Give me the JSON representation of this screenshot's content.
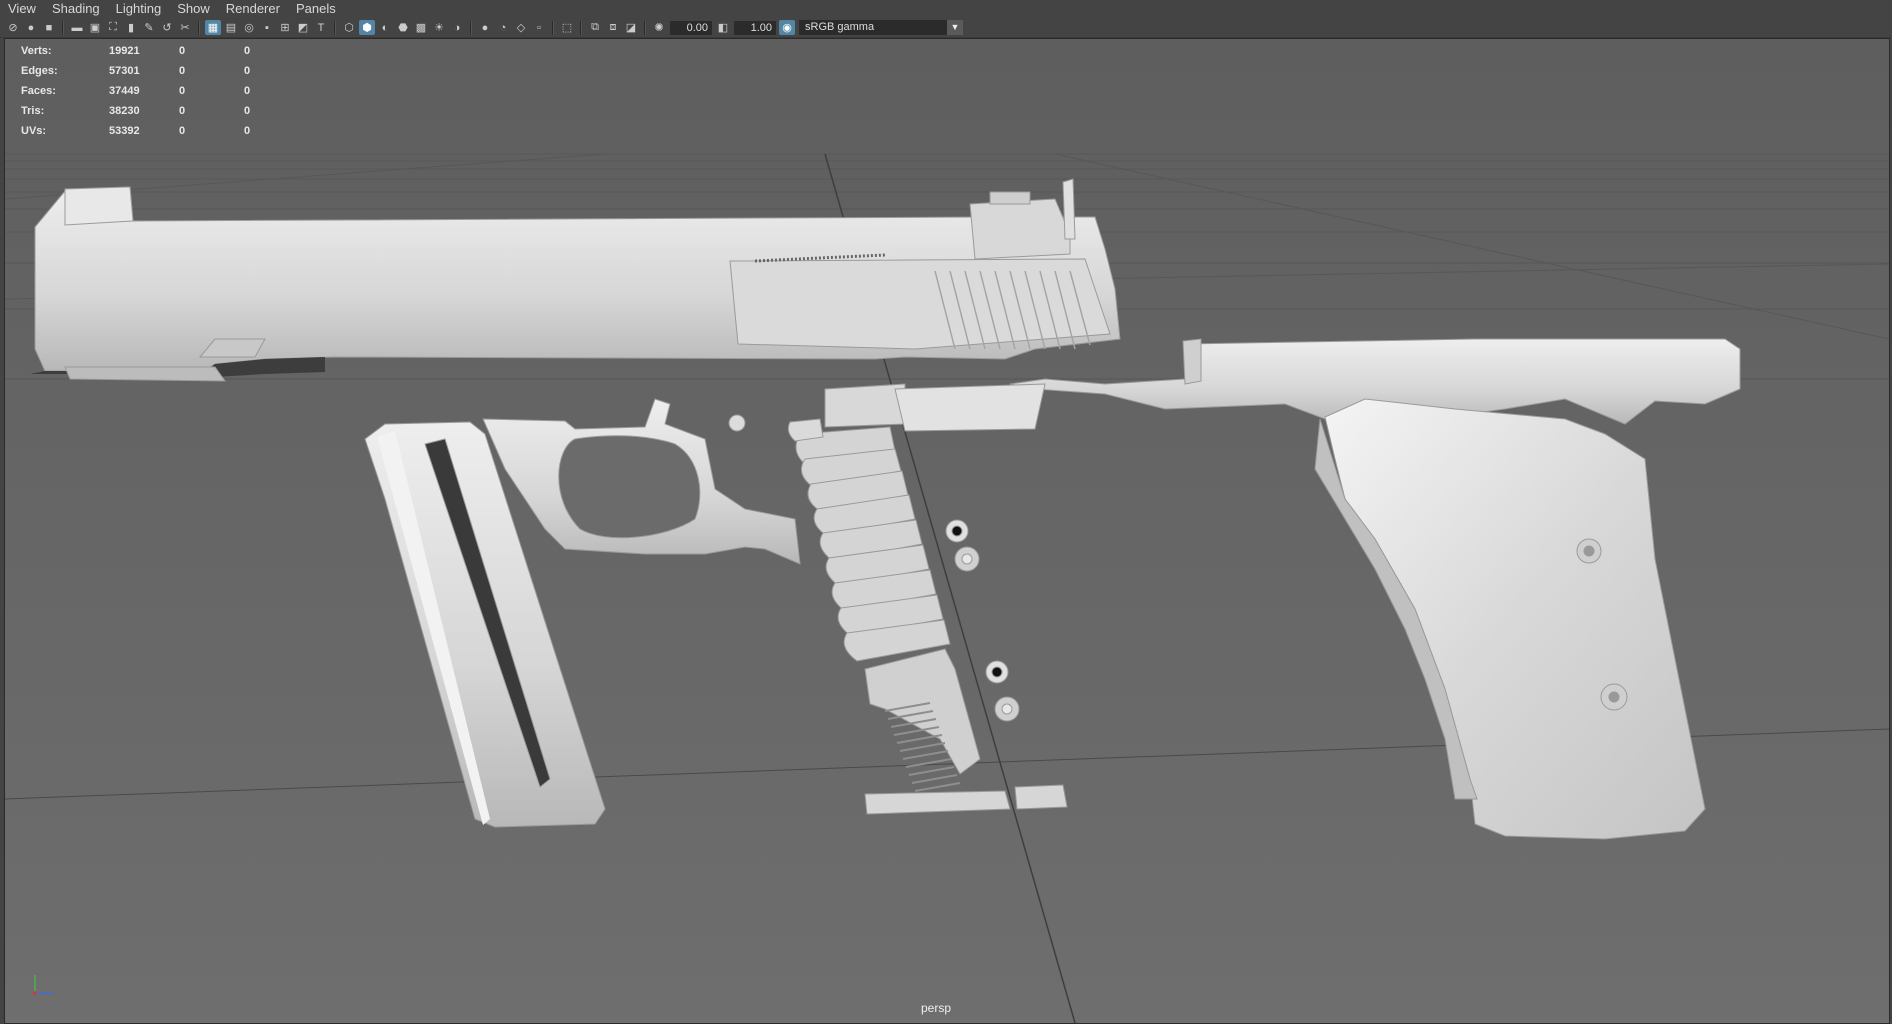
{
  "menu": [
    "View",
    "Shading",
    "Lighting",
    "Show",
    "Renderer",
    "Panels"
  ],
  "toolbar": {
    "exposure": "0.00",
    "gamma": "1.00",
    "color_space": "sRGB gamma"
  },
  "hud": [
    {
      "label": "Verts:",
      "v1": "19921",
      "v2": "0",
      "v3": "0"
    },
    {
      "label": "Edges:",
      "v1": "57301",
      "v2": "0",
      "v3": "0"
    },
    {
      "label": "Faces:",
      "v1": "37449",
      "v2": "0",
      "v3": "0"
    },
    {
      "label": "Tris:",
      "v1": "38230",
      "v2": "0",
      "v3": "0"
    },
    {
      "label": "UVs:",
      "v1": "53392",
      "v2": "0",
      "v3": "0"
    }
  ],
  "camera": "persp",
  "colors": {
    "background": "#6b6b6b",
    "grid": "#5a5a5a",
    "model": "#d9d9d9",
    "accent": "#5285a6"
  }
}
